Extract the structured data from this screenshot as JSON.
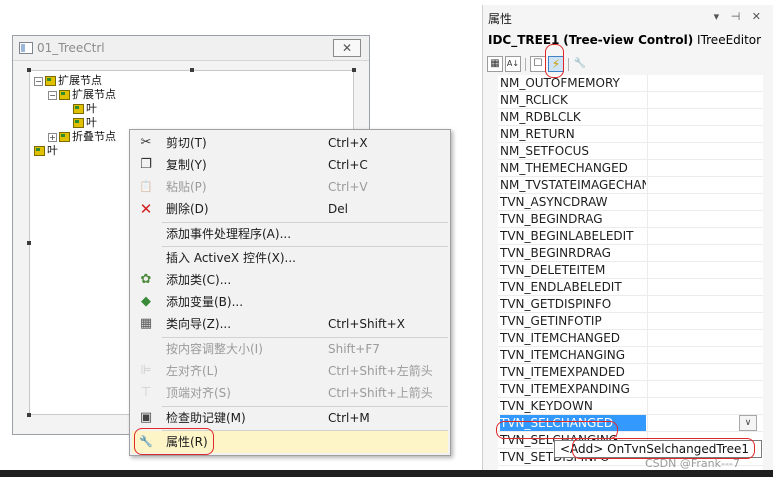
{
  "dialog": {
    "title": "01_TreeCtrl",
    "close_glyph": "✕"
  },
  "tree": {
    "items": [
      {
        "label": "扩展节点",
        "toggle": "−"
      },
      {
        "label": "扩展节点",
        "toggle": "−"
      },
      {
        "label": "叶",
        "toggle": ""
      },
      {
        "label": "叶",
        "toggle": ""
      },
      {
        "label": "折叠节点",
        "toggle": "+"
      },
      {
        "label": "叶",
        "toggle": ""
      }
    ]
  },
  "context_menu": {
    "items": [
      {
        "icon": "cut-icon",
        "glyph": "✂",
        "label": "剪切(T)",
        "shortcut": "Ctrl+X",
        "disabled": false
      },
      {
        "icon": "copy-icon",
        "glyph": "❐",
        "label": "复制(Y)",
        "shortcut": "Ctrl+C",
        "disabled": false
      },
      {
        "icon": "paste-icon",
        "glyph": "📋",
        "label": "粘贴(P)",
        "shortcut": "Ctrl+V",
        "disabled": true
      },
      {
        "icon": "delete-icon",
        "glyph": "✕",
        "label": "删除(D)",
        "shortcut": "Del",
        "disabled": false
      },
      {
        "icon": "",
        "glyph": "",
        "label": "添加事件处理程序(A)...",
        "shortcut": "",
        "disabled": false
      },
      {
        "icon": "",
        "glyph": "",
        "label": "插入 ActiveX 控件(X)...",
        "shortcut": "",
        "disabled": false
      },
      {
        "icon": "add-class-icon",
        "glyph": "✿",
        "label": "添加类(C)...",
        "shortcut": "",
        "disabled": false
      },
      {
        "icon": "add-variable-icon",
        "glyph": "◆",
        "label": "添加变量(B)...",
        "shortcut": "",
        "disabled": false
      },
      {
        "icon": "class-wizard-icon",
        "glyph": "▦",
        "label": "类向导(Z)...",
        "shortcut": "Ctrl+Shift+X",
        "disabled": false
      },
      {
        "icon": "",
        "glyph": "",
        "label": "按内容调整大小(I)",
        "shortcut": "Shift+F7",
        "disabled": true
      },
      {
        "icon": "align-left-icon",
        "glyph": "⊫",
        "label": "左对齐(L)",
        "shortcut": "Ctrl+Shift+左箭头",
        "disabled": true
      },
      {
        "icon": "align-top-icon",
        "glyph": "⊤",
        "label": "顶端对齐(S)",
        "shortcut": "Ctrl+Shift+上箭头",
        "disabled": true
      },
      {
        "icon": "check-mnemonics-icon",
        "glyph": "▣",
        "label": "检查助记键(M)",
        "shortcut": "Ctrl+M",
        "disabled": false
      },
      {
        "icon": "properties-wrench-icon",
        "glyph": "🔧",
        "label": "属性(R)",
        "shortcut": "",
        "disabled": false
      }
    ]
  },
  "properties": {
    "title": "属性",
    "pin_glyphs": "▾ ⊣ ✕",
    "object_id": "IDC_TREE1",
    "object_type": "(Tree-view Control)",
    "object_interface": "ITreeEditor",
    "toolbar": {
      "categorized": "▦",
      "alphabetical": "A↓",
      "properties": "☐",
      "events": "⚡",
      "property_pages": "🔧"
    },
    "events": [
      "NM_OUTOFMEMORY",
      "NM_RCLICK",
      "NM_RDBLCLK",
      "NM_RETURN",
      "NM_SETFOCUS",
      "NM_THEMECHANGED",
      "NM_TVSTATEIMAGECHANGING",
      "TVN_ASYNCDRAW",
      "TVN_BEGINDRAG",
      "TVN_BEGINLABELEDIT",
      "TVN_BEGINRDRAG",
      "TVN_DELETEITEM",
      "TVN_ENDLABELEDIT",
      "TVN_GETDISPINFO",
      "TVN_GETINFOTIP",
      "TVN_ITEMCHANGED",
      "TVN_ITEMCHANGING",
      "TVN_ITEMEXPANDED",
      "TVN_ITEMEXPANDING",
      "TVN_KEYDOWN",
      "TVN_SELCHANGED",
      "TVN_SELCHANGING",
      "TVN_SETDISPINFO"
    ],
    "selected_event": "TVN_SELCHANGED",
    "dropdown_btn_glyph": "∨",
    "dropdown_option": "<Add> OnTvnSelchangedTree1"
  },
  "watermark": "CSDN @Frank---7",
  "colors": {
    "selection": "#3399ff",
    "annotation": "#e0272a",
    "menu_highlight": "#fdf4c8"
  }
}
